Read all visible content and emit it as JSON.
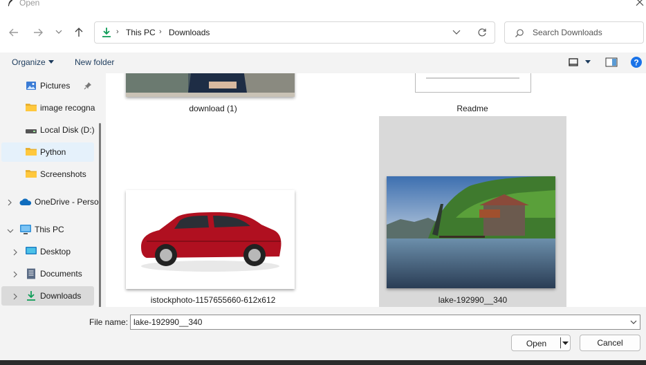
{
  "window": {
    "title": "Open"
  },
  "address_bar": {
    "breadcrumbs": [
      "This PC",
      "Downloads"
    ]
  },
  "search": {
    "placeholder": "Search Downloads"
  },
  "commands": {
    "organize": "Organize",
    "new_folder": "New folder"
  },
  "sidebar": {
    "items": [
      {
        "label": "Pictures",
        "icon": "pictures-icon",
        "pinned": true
      },
      {
        "label": "image recogna",
        "icon": "folder-icon"
      },
      {
        "label": "Local Disk (D:)",
        "icon": "drive-icon"
      },
      {
        "label": "Python",
        "icon": "folder-icon",
        "selected": true
      },
      {
        "label": "Screenshots",
        "icon": "folder-icon"
      },
      {
        "label": "OneDrive - Perso",
        "icon": "onedrive-icon"
      },
      {
        "label": "This PC",
        "icon": "pc-icon",
        "expanded": true
      },
      {
        "label": "Desktop",
        "icon": "desktop-icon"
      },
      {
        "label": "Documents",
        "icon": "documents-icon"
      },
      {
        "label": "Downloads",
        "icon": "downloads-icon",
        "active": true
      }
    ]
  },
  "files": [
    {
      "name": "download (1)",
      "thumbnail": "person-at-laptop"
    },
    {
      "name": "Readme",
      "thumbnail": "document-page"
    },
    {
      "name": "istockphoto-1157655660-612x612",
      "thumbnail": "red-suv"
    },
    {
      "name": "lake-192990__340",
      "thumbnail": "lake-boathouse",
      "selected": true
    }
  ],
  "filename": {
    "label": "File name:",
    "value": "lake-192990__340"
  },
  "buttons": {
    "open": "Open",
    "cancel": "Cancel"
  },
  "colors": {
    "accent": "#0067c0",
    "selection": "#e5f1fb",
    "selected_tile": "#d9d9d9",
    "download_green": "#0f9d58"
  }
}
